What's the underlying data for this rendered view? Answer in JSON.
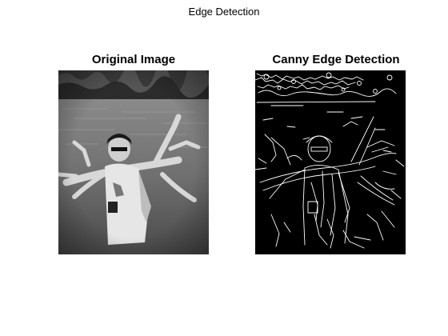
{
  "figure": {
    "title": "Edge Detection"
  },
  "panels": [
    {
      "title": "Original Image"
    },
    {
      "title": "Canny Edge Detection"
    }
  ],
  "colors": {
    "background": "#ffffff",
    "edge_background": "#000000",
    "edge_line": "#ffffff"
  }
}
